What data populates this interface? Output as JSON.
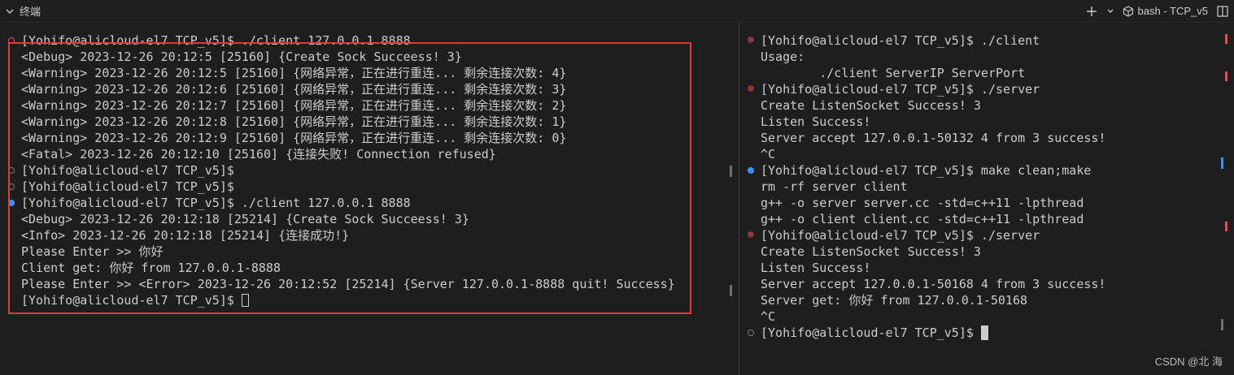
{
  "panel": {
    "title": "终端",
    "shell_label": "bash - TCP_v5"
  },
  "left": {
    "lines": [
      "[Yohifo@alicloud-el7 TCP_v5]$ ./client 127.0.0.1 8888",
      "<Debug> 2023-12-26 20:12:5 [25160] {Create Sock Succeess! 3}",
      "<Warning> 2023-12-26 20:12:5 [25160] {网络异常，正在进行重连... 剩余连接次数: 4}",
      "<Warning> 2023-12-26 20:12:6 [25160] {网络异常，正在进行重连... 剩余连接次数: 3}",
      "<Warning> 2023-12-26 20:12:7 [25160] {网络异常，正在进行重连... 剩余连接次数: 2}",
      "<Warning> 2023-12-26 20:12:8 [25160] {网络异常，正在进行重连... 剩余连接次数: 1}",
      "<Warning> 2023-12-26 20:12:9 [25160] {网络异常，正在进行重连... 剩余连接次数: 0}",
      "<Fatal> 2023-12-26 20:12:10 [25160] {连接失败! Connection refused}",
      "[Yohifo@alicloud-el7 TCP_v5]$",
      "[Yohifo@alicloud-el7 TCP_v5]$",
      "[Yohifo@alicloud-el7 TCP_v5]$ ./client 127.0.0.1 8888",
      "<Debug> 2023-12-26 20:12:18 [25214] {Create Sock Succeess! 3}",
      "<Info> 2023-12-26 20:12:18 [25214] {连接成功!}",
      "Please Enter >> 你好",
      "Client get: 你好 from 127.0.0.1-8888",
      "Please Enter >> <Error> 2023-12-26 20:12:52 [25214] {Server 127.0.0.1-8888 quit! Success}",
      "[Yohifo@alicloud-el7 TCP_v5]$ "
    ]
  },
  "right": {
    "lines": [
      "[Yohifo@alicloud-el7 TCP_v5]$ ./client",
      "Usage:",
      "        ./client ServerIP ServerPort",
      "[Yohifo@alicloud-el7 TCP_v5]$ ./server",
      "Create ListenSocket Success! 3",
      "Listen Success!",
      "Server accept 127.0.0.1-50132 4 from 3 success!",
      "^C",
      "[Yohifo@alicloud-el7 TCP_v5]$ make clean;make",
      "rm -rf server client",
      "g++ -o server server.cc -std=c++11 -lpthread",
      "g++ -o client client.cc -std=c++11 -lpthread",
      "[Yohifo@alicloud-el7 TCP_v5]$ ./server",
      "Create ListenSocket Success! 3",
      "Listen Success!",
      "Server accept 127.0.0.1-50168 4 from 3 success!",
      "Server get: 你好 from 127.0.0.1-50168",
      "^C",
      "[Yohifo@alicloud-el7 TCP_v5]$ "
    ]
  },
  "watermark": "CSDN @北  海",
  "colors": {
    "error": "#f14c4c",
    "success_dot": "#3794ff",
    "highlight": "#e53935"
  }
}
